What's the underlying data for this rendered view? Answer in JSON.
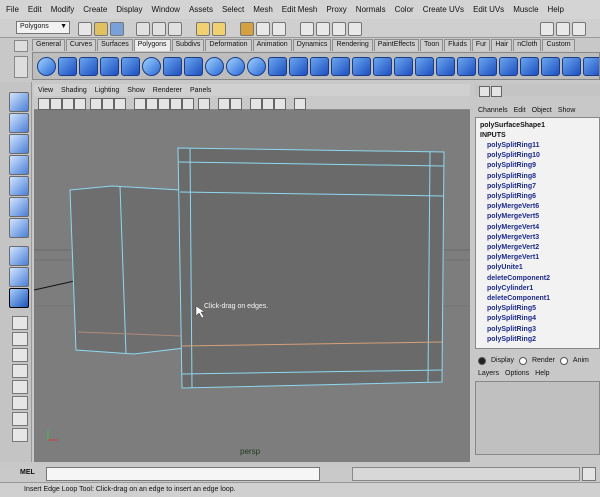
{
  "menubar": [
    "File",
    "Edit",
    "Modify",
    "Create",
    "Display",
    "Window",
    "Assets",
    "Select",
    "Mesh",
    "Edit Mesh",
    "Proxy",
    "Normals",
    "Color",
    "Create UVs",
    "Edit UVs",
    "Muscle",
    "Help"
  ],
  "statusline": {
    "mode": "Polygons"
  },
  "shelf": {
    "tabs": [
      "General",
      "Curves",
      "Surfaces",
      "Polygons",
      "Subdivs",
      "Deformation",
      "Animation",
      "Dynamics",
      "Rendering",
      "PaintEffects",
      "Toon",
      "Fluids",
      "Fur",
      "Hair",
      "nCloth",
      "Custom"
    ],
    "active_tab": "Polygons"
  },
  "panel": {
    "menus": [
      "View",
      "Shading",
      "Lighting",
      "Show",
      "Renderer",
      "Panels"
    ],
    "camera": "persp",
    "hint": "Click-drag on edges."
  },
  "channel_box": {
    "menus": [
      "Channels",
      "Edit",
      "Object",
      "Show"
    ],
    "shape": "polySurfaceShape1",
    "inputs_label": "INPUTS",
    "nodes": [
      "polySplitRing11",
      "polySplitRing10",
      "polySplitRing9",
      "polySplitRing8",
      "polySplitRing7",
      "polySplitRing6",
      "polyMergeVert6",
      "polyMergeVert5",
      "polyMergeVert4",
      "polyMergeVert3",
      "polyMergeVert2",
      "polyMergeVert1",
      "polyUnite1",
      "deleteComponent2",
      "polyCylinder1",
      "deleteComponent1",
      "polySplitRing5",
      "polySplitRing4",
      "polySplitRing3",
      "polySplitRing2"
    ]
  },
  "layer_editor": {
    "radios": [
      "Display",
      "Render",
      "Anim"
    ],
    "menus": [
      "Layers",
      "Options",
      "Help"
    ]
  },
  "command_line": {
    "label": "MEL"
  },
  "help_line": "Insert Edge Loop Tool: Click-drag on an edge to insert an edge loop."
}
